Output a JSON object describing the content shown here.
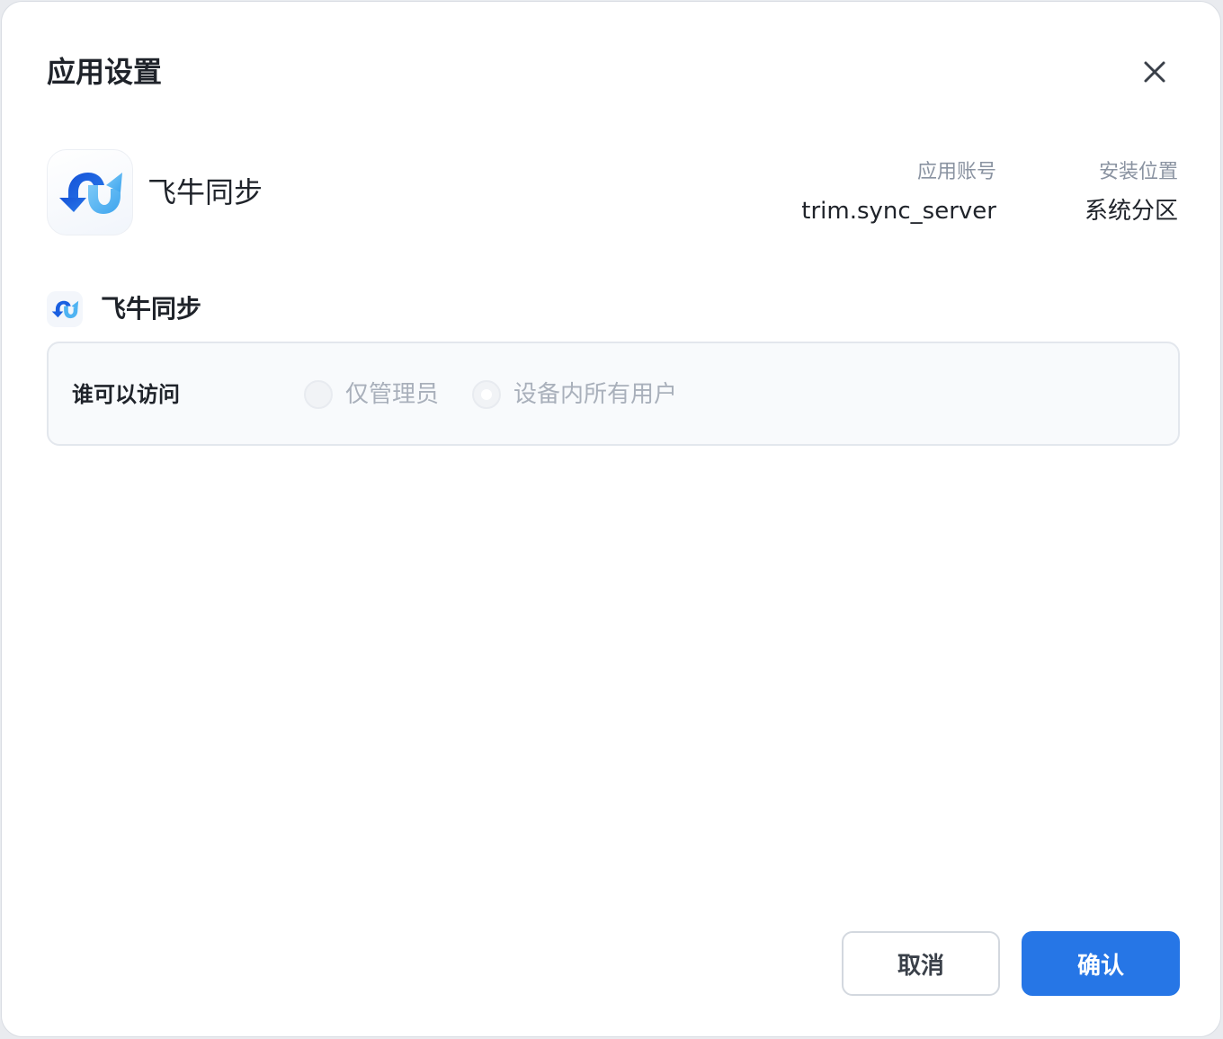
{
  "dialog": {
    "title": "应用设置",
    "close_icon": "close-icon"
  },
  "app": {
    "name": "飞牛同步",
    "icon": "fn-sync-logo-icon",
    "account_label": "应用账号",
    "account_value": "trim.sync_server",
    "location_label": "安装位置",
    "location_value": "系统分区"
  },
  "section": {
    "title": "飞牛同步",
    "access": {
      "label": "谁可以访问",
      "options": [
        {
          "label": "仅管理员",
          "selected": false,
          "disabled": true
        },
        {
          "label": "设备内所有用户",
          "selected": true,
          "disabled": true
        }
      ]
    }
  },
  "footer": {
    "cancel_label": "取消",
    "confirm_label": "确认"
  },
  "colors": {
    "accent": "#2676e6",
    "logo_dark": "#1a5fe0",
    "logo_light": "#4fb3f2"
  }
}
